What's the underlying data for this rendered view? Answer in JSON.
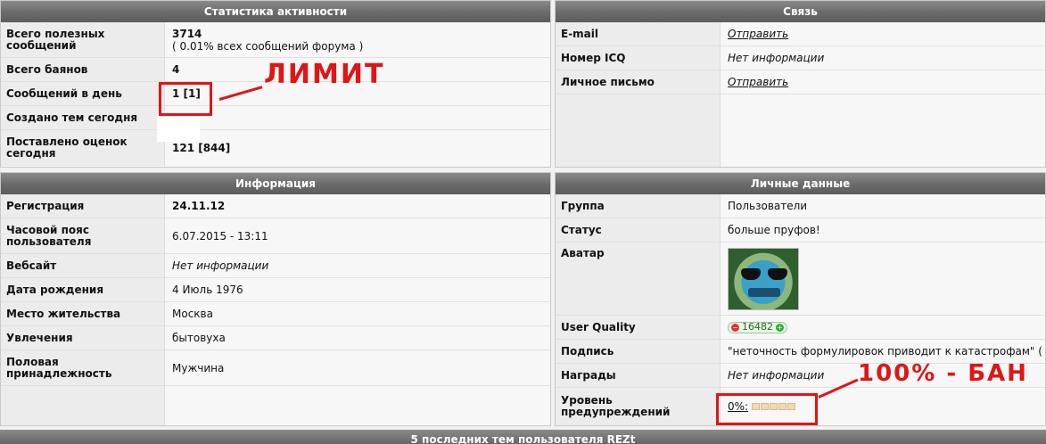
{
  "activity": {
    "title": "Статистика активности",
    "rows": [
      {
        "label": "Всего полезных сообщений",
        "value": "3714",
        "sub": "( 0.01% всех сообщений форума )"
      },
      {
        "label": "Всего баянов",
        "value": "4"
      },
      {
        "label": "Сообщений в день",
        "value": "1 [1]"
      },
      {
        "label": "Создано тем сегодня",
        "value": ""
      },
      {
        "label": "Поставлено оценок сегодня",
        "value": "121 [844]"
      }
    ]
  },
  "contact": {
    "title": "Связь",
    "rows": [
      {
        "label": "E-mail",
        "value": "Отправить"
      },
      {
        "label": "Номер ICQ",
        "value": "Нет информации"
      },
      {
        "label": "Личное письмо",
        "value": "Отправить"
      }
    ]
  },
  "info": {
    "title": "Информация",
    "rows": [
      {
        "label": "Регистрация",
        "value": "24.11.12"
      },
      {
        "label": "Часовой пояс пользователя",
        "value": "6.07.2015 - 13:11"
      },
      {
        "label": "Вебсайт",
        "value": "Нет информации"
      },
      {
        "label": "Дата рождения",
        "value": "4 Июль 1976"
      },
      {
        "label": "Место жительства",
        "value": "Москва"
      },
      {
        "label": "Увлечения",
        "value": "бытовуха"
      },
      {
        "label": "Половая принадлежность",
        "value": "Мужчина"
      }
    ]
  },
  "personal": {
    "title": "Личные данные",
    "rows": [
      {
        "label": "Группа",
        "value": "Пользователи"
      },
      {
        "label": "Статус",
        "value": "больше пруфов!"
      },
      {
        "label": "Аватар",
        "value": ""
      },
      {
        "label": "User Quality",
        "value": "16482"
      },
      {
        "label": "Подпись",
        "value": "\"неточность формулировок приводит к катастрофам\" ("
      },
      {
        "label": "Награды",
        "value": "Нет информации"
      },
      {
        "label": "Уровень предупреждений",
        "value": "0%:"
      }
    ],
    "warning_level_percent": 0
  },
  "footer": {
    "title": "5 последних тем пользователя REZt"
  },
  "annotations": {
    "limit": "ЛИМИТ",
    "ban": "100% - БАН",
    "color": "#e01515"
  },
  "icons": {
    "minus": "−",
    "plus": "+"
  }
}
